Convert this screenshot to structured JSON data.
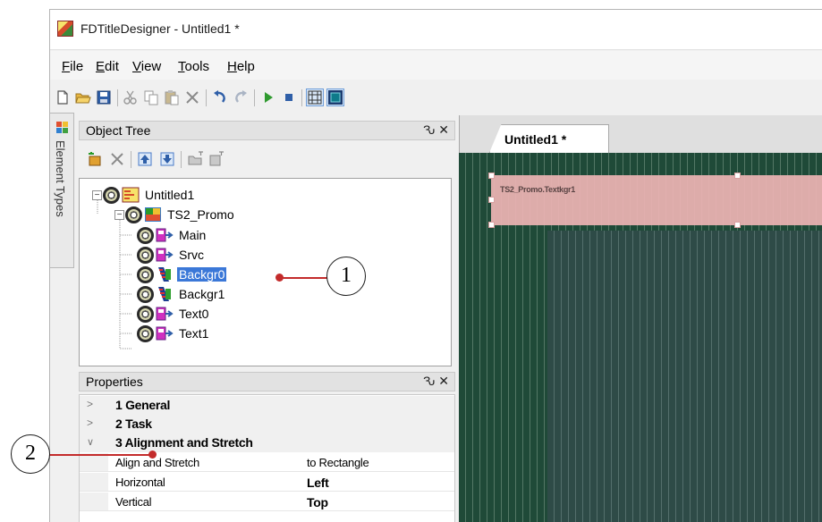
{
  "window": {
    "title": "FDTitleDesigner - Untitled1 *"
  },
  "menu": {
    "items": [
      "File",
      "Edit",
      "View",
      "Tools",
      "Help"
    ]
  },
  "toolbar": {
    "buttons": [
      "new-document-icon",
      "open-folder-icon",
      "save-icon",
      "cut-icon",
      "copy-icon",
      "paste-icon",
      "delete-icon",
      "undo-icon",
      "redo-icon",
      "play-icon",
      "stop-icon",
      "grid-icon",
      "safe-area-icon"
    ]
  },
  "side_tab": {
    "label": "Element Types"
  },
  "object_tree": {
    "title": "Object Tree",
    "pin_close": "Ԅ ✕",
    "nodes": [
      {
        "label": "Untitled1",
        "level": 0,
        "expanded": true,
        "icon": "project-icon",
        "selected": false
      },
      {
        "label": "TS2_Promo",
        "level": 1,
        "expanded": true,
        "icon": "titleset-icon",
        "selected": false
      },
      {
        "label": "Main",
        "level": 2,
        "icon": "element-icon",
        "selected": false
      },
      {
        "label": "Srvc",
        "level": 2,
        "icon": "element-icon",
        "selected": false
      },
      {
        "label": "Backgr0",
        "level": 2,
        "icon": "filmstrip-icon",
        "selected": true
      },
      {
        "label": "Backgr1",
        "level": 2,
        "icon": "filmstrip-icon",
        "selected": false
      },
      {
        "label": "Text0",
        "level": 2,
        "icon": "element-icon",
        "selected": false
      },
      {
        "label": "Text1",
        "level": 2,
        "icon": "element-icon",
        "selected": false
      }
    ]
  },
  "properties": {
    "title": "Properties",
    "pin_close": "Ԅ ✕",
    "categories": [
      {
        "label": "1 General",
        "expanded": false
      },
      {
        "label": "2 Task",
        "expanded": false
      },
      {
        "label": "3 Alignment and Stretch",
        "expanded": true
      }
    ],
    "rows": [
      {
        "name": "Align and Stretch",
        "value": "to Rectangle",
        "bold": false
      },
      {
        "name": "Horizontal",
        "value": "Left",
        "bold": true
      },
      {
        "name": "Vertical",
        "value": "Top",
        "bold": true
      }
    ]
  },
  "document": {
    "tab_label": "Untitled1 *",
    "element_label": "TS2_Promo.Textkgr1"
  },
  "callouts": {
    "one": "1",
    "two": "2"
  },
  "colors": {
    "canvas": "#1f4a38",
    "safe_zone": "#2e4b47",
    "selection": "#3b78d8",
    "callout_red": "#c32b2b",
    "promo_rect": "#eeb4b4"
  }
}
